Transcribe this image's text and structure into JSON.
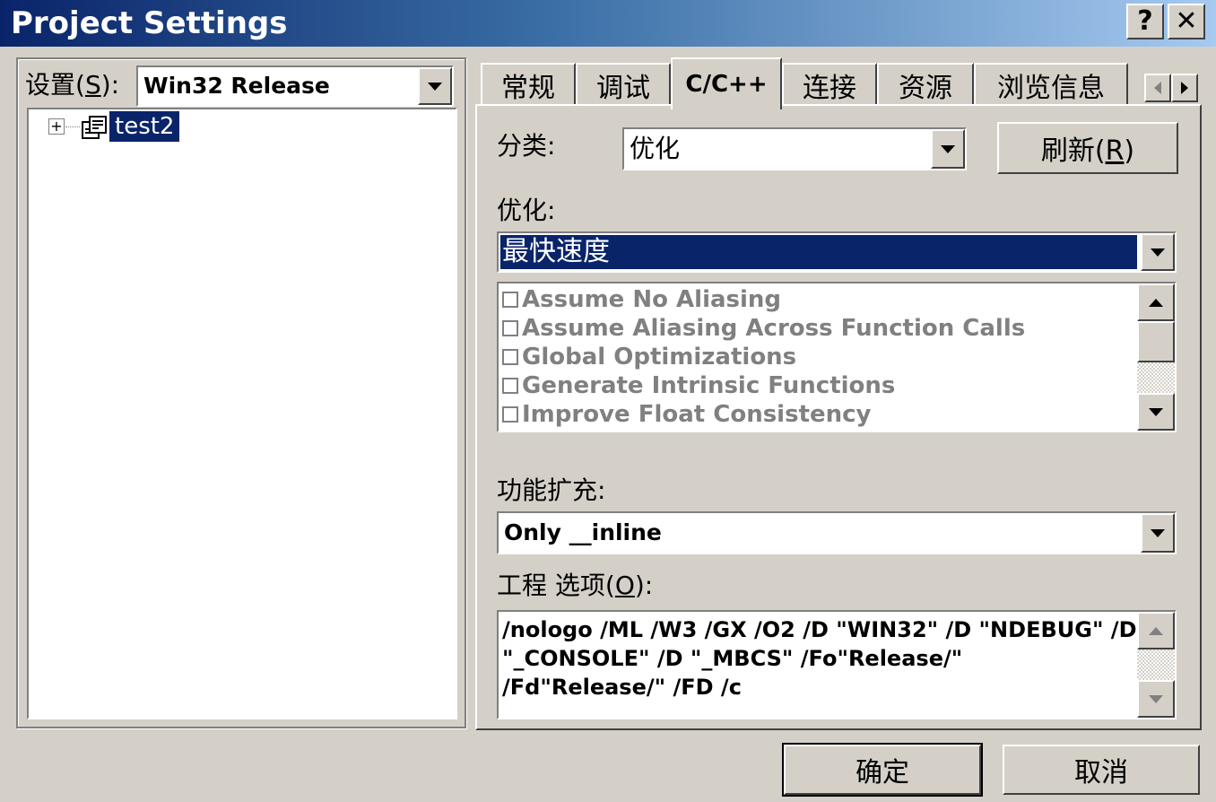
{
  "window": {
    "title": "Project Settings",
    "help_button": "?",
    "close_button": "✕"
  },
  "left_panel": {
    "settings_label_pre": "设置(",
    "settings_label_key": "S",
    "settings_label_post": "):",
    "config_value": "Win32 Release",
    "tree": {
      "expand_glyph": "+",
      "project_name": "test2",
      "selected": true
    }
  },
  "tabs": [
    {
      "label": "常规",
      "active": false
    },
    {
      "label": "调试",
      "active": false
    },
    {
      "label": "C/C++",
      "active": true
    },
    {
      "label": "连接",
      "active": false
    },
    {
      "label": "资源",
      "active": false
    },
    {
      "label": "浏览信息",
      "active": false
    }
  ],
  "cpp": {
    "category_label": "分类:",
    "category_value": "优化",
    "reset_label_pre": "刷新(",
    "reset_label_key": "R",
    "reset_label_post": ")",
    "optimization_label": "优化:",
    "optimization_value": "最快速度",
    "options": [
      {
        "label": "Assume No Aliasing",
        "checked": false
      },
      {
        "label": "Assume Aliasing Across Function Calls",
        "checked": false
      },
      {
        "label": "Global Optimizations",
        "checked": false
      },
      {
        "label": "Generate Intrinsic Functions",
        "checked": false
      },
      {
        "label": "Improve Float Consistency",
        "checked": false
      }
    ],
    "inline_label": "功能扩充:",
    "inline_value": "Only __inline",
    "project_options_label_pre": "工程 选项(",
    "project_options_label_key": "O",
    "project_options_label_post": "):",
    "project_options_lines": [
      "/nologo /ML /W3 /GX /O2 /D \"WIN32\" /D \"NDEBUG\" /D",
      "\"_CONSOLE\" /D \"_MBCS\" /Fo\"Release/\"",
      "/Fd\"Release/\" /FD /c"
    ]
  },
  "footer": {
    "ok_label": "确定",
    "cancel_label": "取消"
  },
  "colors": {
    "face": "#d4d0c8",
    "selection": "#0a246a",
    "title_gradient_start": "#0a246a",
    "title_gradient_end": "#a6caf0",
    "disabled_text": "#808080"
  }
}
